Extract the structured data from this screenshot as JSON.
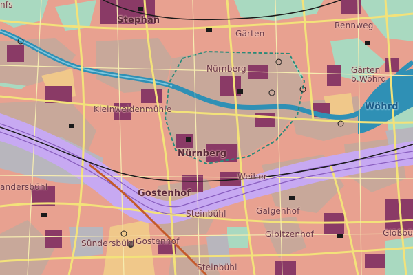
{
  "map": {
    "colors": {
      "residential": "#e8a190",
      "mixed_core": "#c8a89a",
      "commercial": "#8a3a66",
      "industrial": "#b7b7bd",
      "rail": "#c8a8f0",
      "water": "#2f90b5",
      "park": "#a9d9c0",
      "road": "#f3e27a",
      "railway_line": "#c45a2a",
      "boundary": "#1a1a1a"
    },
    "places": [
      {
        "name": "Stephan",
        "style": "big"
      },
      {
        "name": "Gärten",
        "style": "normal"
      },
      {
        "name": "Rennweg",
        "style": "normal"
      },
      {
        "name": "Gärten",
        "style": "normal"
      },
      {
        "name": "b.Wöhrd",
        "style": "normal"
      },
      {
        "name": "Wöhrd",
        "style": "big"
      },
      {
        "name": "Kleinweidenmühle",
        "style": "normal"
      },
      {
        "name": "Nürnberg",
        "style": "big"
      },
      {
        "name": "Weiher",
        "style": "normal"
      },
      {
        "name": "andersbühl",
        "style": "normal"
      },
      {
        "name": "Gostenhof",
        "style": "big"
      },
      {
        "name": "Steinbühl",
        "style": "normal"
      },
      {
        "name": "Galgenhof",
        "style": "normal"
      },
      {
        "name": "Gibitzenhof",
        "style": "normal"
      },
      {
        "name": "Gostenhof",
        "style": "normal"
      },
      {
        "name": "Sündersbühl",
        "style": "normal"
      },
      {
        "name": "Steinbühl",
        "style": "normal"
      },
      {
        "name": "Glößbühl",
        "style": "normal"
      },
      {
        "name": "Nürnberg",
        "style": "normal"
      },
      {
        "name": "nfs",
        "style": "normal"
      }
    ]
  }
}
